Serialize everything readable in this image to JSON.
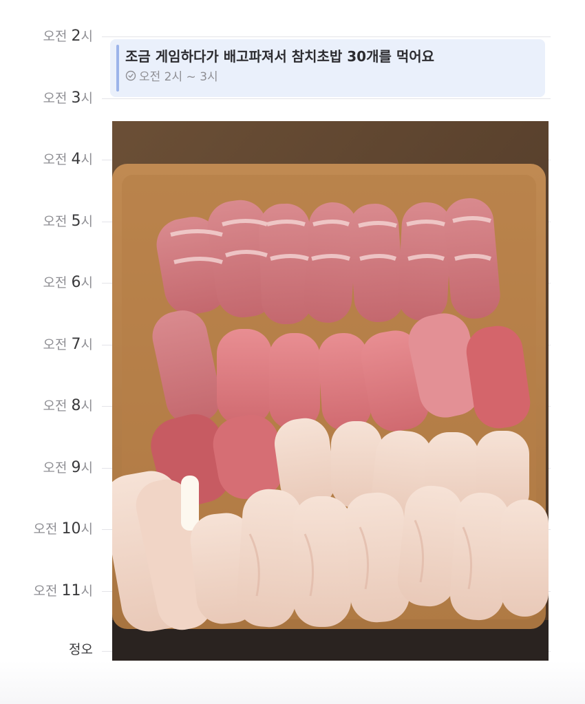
{
  "timeline": {
    "hours": [
      {
        "period": "오전",
        "num": "2",
        "unit": "시"
      },
      {
        "period": "오전",
        "num": "3",
        "unit": "시"
      },
      {
        "period": "오전",
        "num": "4",
        "unit": "시"
      },
      {
        "period": "오전",
        "num": "5",
        "unit": "시"
      },
      {
        "period": "오전",
        "num": "6",
        "unit": "시"
      },
      {
        "period": "오전",
        "num": "7",
        "unit": "시"
      },
      {
        "period": "오전",
        "num": "8",
        "unit": "시"
      },
      {
        "period": "오전",
        "num": "9",
        "unit": "시"
      },
      {
        "period": "오전",
        "num": "10",
        "unit": "시"
      },
      {
        "period": "오전",
        "num": "11",
        "unit": "시"
      },
      {
        "period": "정오",
        "num": "",
        "unit": ""
      }
    ]
  },
  "event": {
    "title": "조금 게임하다가 배고파져서 참치초밥 30개를 먹어요",
    "time": "오전 2시 ~ 3시",
    "accent_color": "#9cb4ea",
    "background_color": "#eaf0fb"
  },
  "photo": {
    "icon": "sushi-photo"
  }
}
